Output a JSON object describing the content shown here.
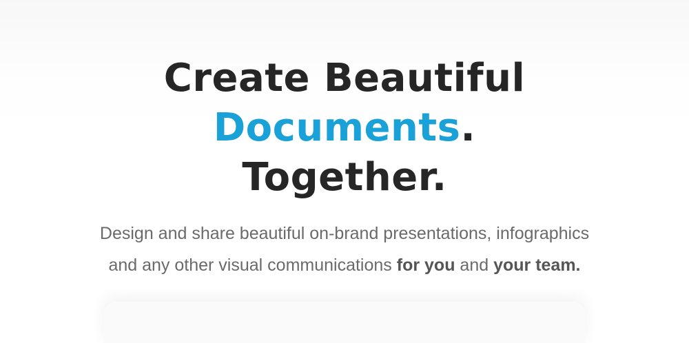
{
  "headline": {
    "line1": "Create Beautiful",
    "line2_accent": "Documents",
    "line2_suffix": ".",
    "line3": "Together."
  },
  "subtitle": {
    "line1": "Design and share beautiful on-brand presentations, infographics",
    "line2_prefix": "and any other visual communications ",
    "line2_bold1": "for you",
    "line2_middle": " and ",
    "line2_bold2": "your team."
  },
  "colors": {
    "heading": "#262626",
    "accent": "#1aa1d7",
    "subtitle": "#6a6a6a"
  }
}
